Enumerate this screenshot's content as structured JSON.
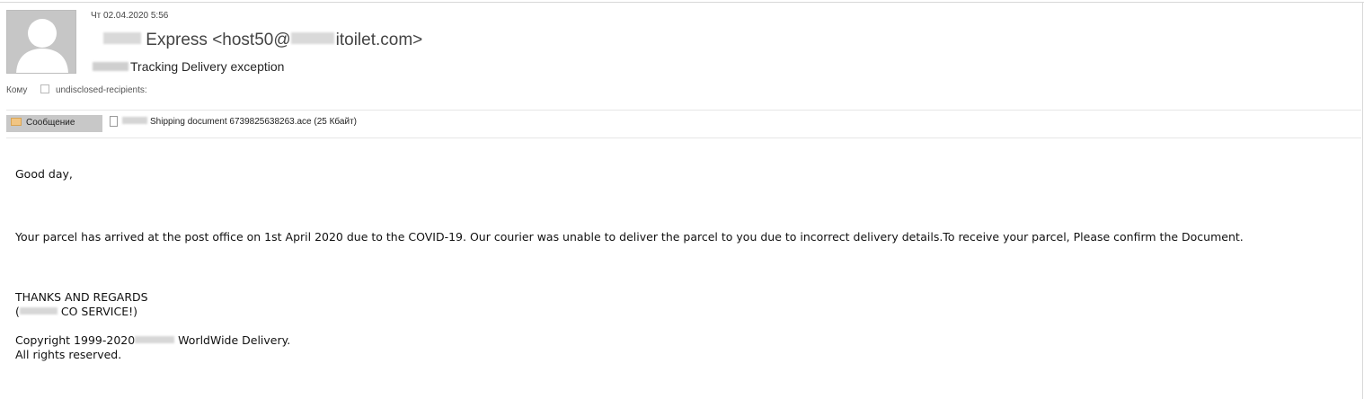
{
  "header": {
    "date": "Чт 02.04.2020 5:56",
    "from_visible": "Express <host50@",
    "from_domain": "itoilet.com>",
    "subject": "Tracking Delivery exception",
    "to_label": "Кому",
    "to_value": "undisclosed-recipients:"
  },
  "attachments_bar": {
    "message_tab_label": "Сообщение",
    "attachment_label": "Shipping document 6739825638263.ace (25 Кбайт)"
  },
  "body": {
    "greeting": "Good day,",
    "paragraph": "Your parcel has arrived at the post office on 1st April 2020 due to the COVID-19. Our courier was unable to deliver the parcel to you due to incorrect delivery details.To receive your parcel,  Please confirm  the Document.",
    "thanks": "THANKS AND REGARDS",
    "service_open": "(",
    "service_rest": " CO SERVICE!)",
    "copyright_prefix": "Copyright 1999-2020",
    "copyright_suffix": " WorldWide Delivery.",
    "rights": "All rights reserved."
  },
  "icons": {
    "avatar": "person-silhouette-icon",
    "message_tab": "envelope-icon",
    "attachment": "document-icon"
  },
  "colors": {
    "avatar_bg": "#c6c6c6",
    "tab_bg": "#c8c8c8",
    "envelope": "#f1c583"
  }
}
